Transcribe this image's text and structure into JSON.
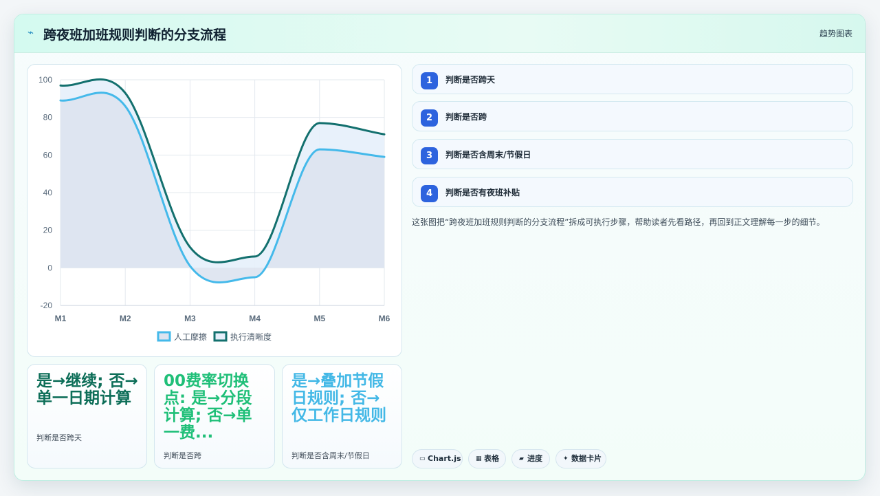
{
  "header": {
    "title": "跨夜班加班规则判断的分支流程",
    "right_label": "趋势图表",
    "icon": "lightning-icon"
  },
  "chart_data": {
    "type": "line",
    "x": [
      "M1",
      "M2",
      "M3",
      "M4",
      "M5",
      "M6"
    ],
    "ylim": [
      -20,
      100
    ],
    "yticks": [
      100,
      80,
      60,
      40,
      20,
      0,
      -20
    ],
    "grid": true,
    "legend_position": "bottom",
    "series": [
      {
        "name": "人工摩擦",
        "values": [
          89,
          86,
          1,
          -5,
          63,
          59
        ],
        "color": "#44b9ea",
        "fill": "#dde3ef"
      },
      {
        "name": "执行清晰度",
        "values": [
          97,
          93,
          11,
          6,
          77,
          71
        ],
        "color": "#13706e",
        "fill": "#e6effb"
      }
    ]
  },
  "stats": [
    {
      "value": "是→继续; 否→单一日期计算",
      "label": "判断是否跨天",
      "color": "#0d6e58"
    },
    {
      "value": "00费率切换点: 是→分段计算; 否→单一费...",
      "label": "判断是否跨",
      "color": "#1fbf78"
    },
    {
      "value": "是→叠加节假日规则; 否→仅工作日规则",
      "label": "判断是否含周末/节假日",
      "color": "#43b8e6"
    }
  ],
  "steps": [
    {
      "num": "1",
      "text": "判断是否跨天"
    },
    {
      "num": "2",
      "text": "判断是否跨"
    },
    {
      "num": "3",
      "text": "判断是否含周末/节假日"
    },
    {
      "num": "4",
      "text": "判断是否有夜班补贴"
    }
  ],
  "description": "这张图把“跨夜班加班规则判断的分支流程”拆成可执行步骤，帮助读者先看路径，再回到正文理解每一步的细节。",
  "tags": [
    {
      "icon": "▭",
      "label": "Chart.js"
    },
    {
      "icon": "▦",
      "label": "表格"
    },
    {
      "icon": "▰",
      "label": "进度"
    },
    {
      "icon": "✦",
      "label": "数据卡片"
    }
  ]
}
